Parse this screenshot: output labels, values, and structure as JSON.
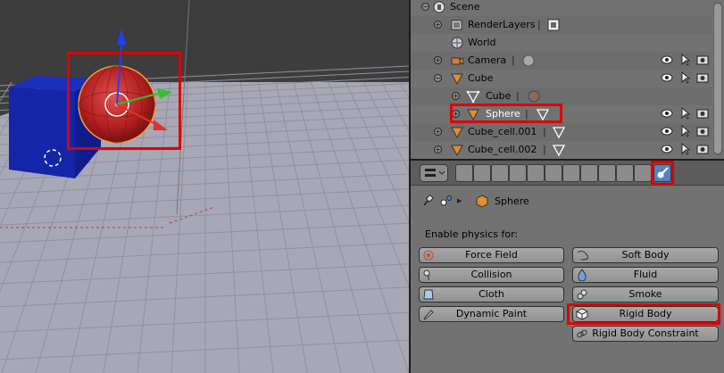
{
  "outliner": {
    "rows": [
      {
        "label": "Scene"
      },
      {
        "label": "RenderLayers"
      },
      {
        "label": "World"
      },
      {
        "label": "Camera"
      },
      {
        "label": "Cube"
      },
      {
        "label": "Cube"
      },
      {
        "label": "Sphere"
      },
      {
        "label": "Cube_cell.001"
      },
      {
        "label": "Cube_cell.002"
      }
    ]
  },
  "properties": {
    "breadcrumb_object": "Sphere",
    "physics_title": "Enable physics for:",
    "buttons": {
      "force_field": "Force Field",
      "collision": "Collision",
      "cloth": "Cloth",
      "dynamic_paint": "Dynamic Paint",
      "soft_body": "Soft Body",
      "fluid": "Fluid",
      "smoke": "Smoke",
      "rigid_body": "Rigid Body",
      "rigid_body_constraint": "Rigid Body Constraint"
    }
  },
  "colors": {
    "highlight": "#e00000",
    "selected_object": "#ffffff",
    "active_context": "#5680c2"
  }
}
